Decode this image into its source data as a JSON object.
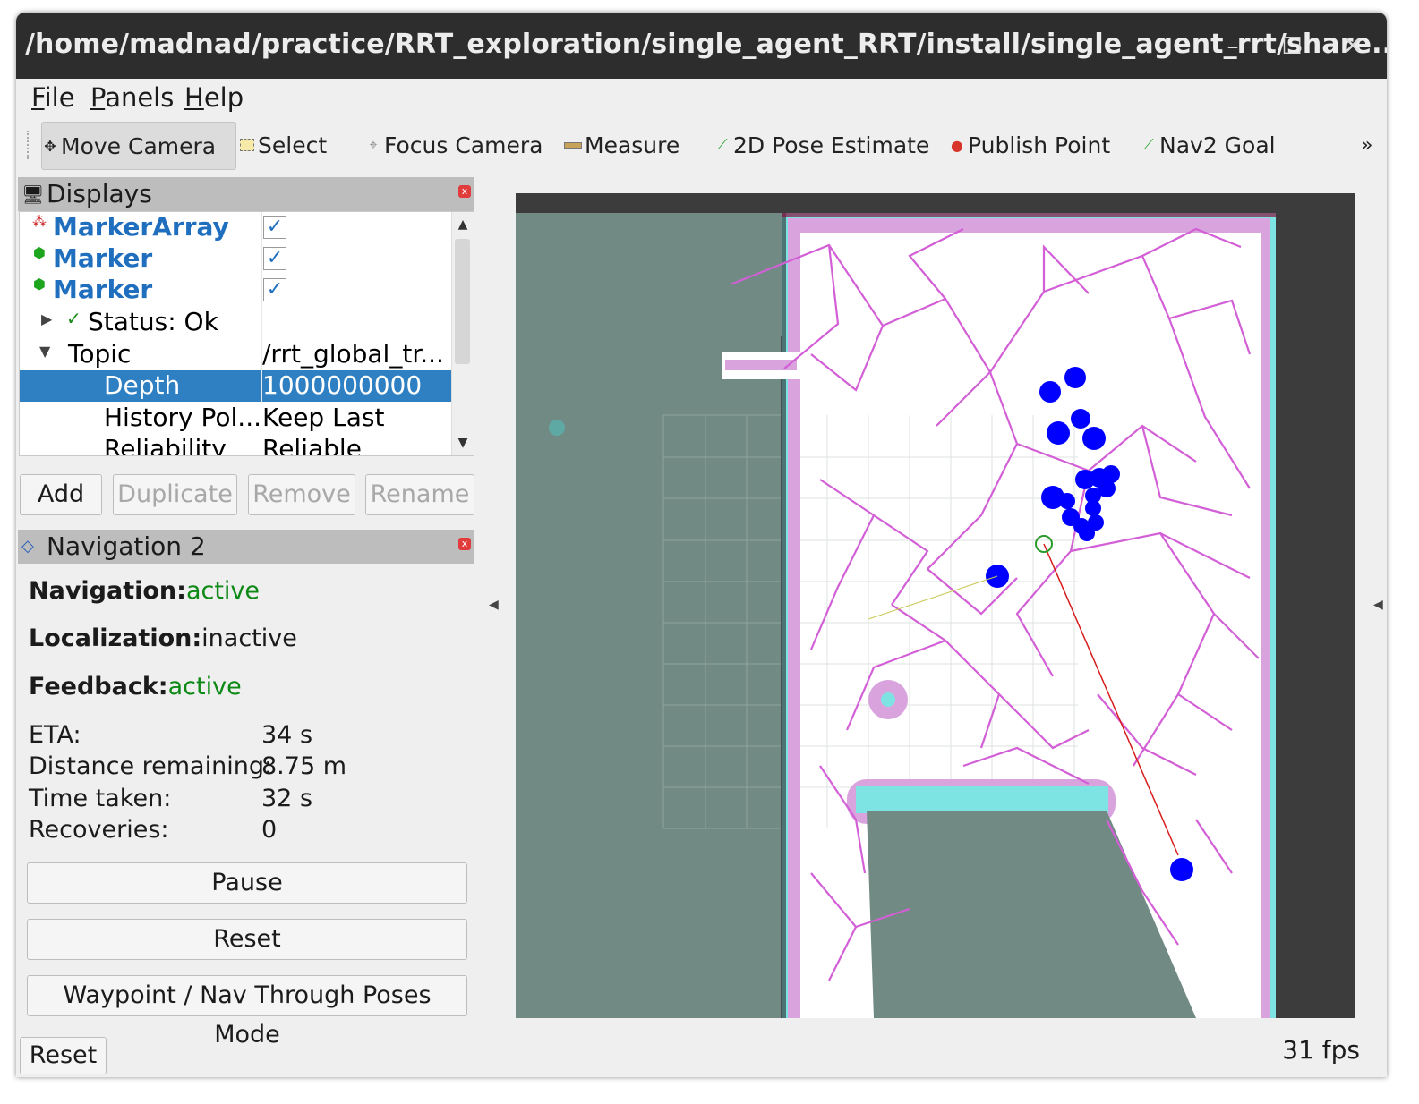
{
  "window": {
    "title": "/home/madnad/practice/RRT_exploration/single_agent_RRT/install/single_agent_rrt/share...",
    "minimize": "–",
    "maximize": "☐",
    "close": "✕"
  },
  "menu": {
    "file": {
      "ul": "F",
      "rest": "ile"
    },
    "panels": {
      "ul": "P",
      "rest": "anels"
    },
    "help": {
      "ul": "H",
      "rest": "elp"
    }
  },
  "toolbar": {
    "move_camera": "Move Camera",
    "select": "Select",
    "focus_camera": "Focus Camera",
    "measure": "Measure",
    "pose_estimate": "2D Pose Estimate",
    "publish_point": "Publish Point",
    "nav2_goal": "Nav2 Goal",
    "overflow": "»"
  },
  "displays": {
    "title": "Displays",
    "rows": [
      {
        "label": "MarkerArray",
        "checked": "✓"
      },
      {
        "label": "Marker",
        "checked": "✓"
      },
      {
        "label": "Marker",
        "checked": "✓"
      },
      {
        "label": "Status: Ok",
        "expander": "▶",
        "status_icon": "✓"
      },
      {
        "label": "Topic",
        "value": "/rrt_global_tr...",
        "expander": "▼"
      },
      {
        "label": "Depth",
        "value": "1000000000"
      },
      {
        "label": "History Pol...",
        "value": "Keep Last"
      },
      {
        "label": "Reliability",
        "value": "Reliable"
      }
    ],
    "buttons": {
      "add": "Add",
      "duplicate": "Duplicate",
      "remove": "Remove",
      "rename": "Rename"
    }
  },
  "navigation": {
    "title": "Navigation 2",
    "navigation_label": "Navigation:",
    "navigation_value": "active",
    "localization_label": "Localization:",
    "localization_value": "inactive",
    "feedback_label": "Feedback:",
    "feedback_value": "active",
    "stats": [
      {
        "label": "ETA:",
        "value": "34 s"
      },
      {
        "label": "Distance remaining:",
        "value": "8.75 m"
      },
      {
        "label": "Time taken:",
        "value": "32 s"
      },
      {
        "label": "Recoveries:",
        "value": "0"
      }
    ],
    "pause": "Pause",
    "reset": "Reset",
    "waypoint": "Waypoint / Nav Through Poses Mode"
  },
  "status_bar": {
    "reset": "Reset",
    "fps": "31 fps"
  },
  "colors": {
    "map_unknown": "#718b84",
    "map_free": "#ffffff",
    "inflation": "#d9a4de",
    "costmap_edge": "#7ee3e3",
    "tree_edges": "#d35fd6",
    "frontier_points": "#0000ff",
    "selection": "#2f80c3"
  }
}
